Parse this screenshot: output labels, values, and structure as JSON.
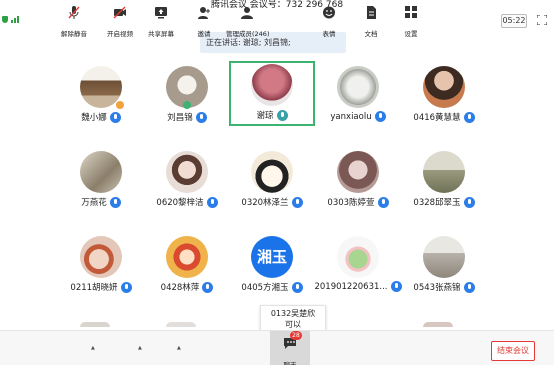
{
  "window": {
    "title": "腾讯会议 会议号：732 296 768",
    "timer": "05:22"
  },
  "speaking": {
    "label": "正在讲话:",
    "names": "谢琼; 刘昌锦;"
  },
  "participants": [
    {
      "name": "魏小娜",
      "avatar_color": "#8b6a4a",
      "badge": "host"
    },
    {
      "name": "刘昌锦",
      "avatar_color": "#a79b8d",
      "badge": "speaking"
    },
    {
      "name": "谢琼",
      "avatar_color": "#b0525f",
      "active": true
    },
    {
      "name": "yanxiaolu",
      "avatar_color": "#c9ccc5"
    },
    {
      "name": "0416黄慧慧",
      "avatar_color": "#6b4a3a"
    },
    {
      "name": "万燕花",
      "avatar_color": "#b3aa9a"
    },
    {
      "name": "0620黎梓洁",
      "avatar_color": "#d8c7bf"
    },
    {
      "name": "0320林泽兰",
      "avatar_color": "#efe6d8"
    },
    {
      "name": "0303陈婷萱",
      "avatar_color": "#9c7c79"
    },
    {
      "name": "0328邱翠玉",
      "avatar_color": "#a8a894"
    },
    {
      "name": "0211胡晓妍",
      "avatar_color": "#c59b86"
    },
    {
      "name": "0428林萍",
      "avatar_color": "#cc7b48"
    },
    {
      "name": "0405方湘玉",
      "avatar_color": "#1a73e8",
      "avatar_text": "湘玉"
    },
    {
      "name": "201901220631...",
      "avatar_color": "#f4f4f4"
    },
    {
      "name": "0543张燕锦",
      "avatar_color": "#b8b2aa"
    }
  ],
  "tooltip": {
    "line1": "0132吴楚欣",
    "line2": "可以"
  },
  "toolbar": {
    "unmute": "解除静音",
    "start_video": "开启视频",
    "share_screen": "共享屏幕",
    "invite": "邀请",
    "members": "管理成员(246)",
    "chat": "聊天",
    "chat_badge": "28",
    "reactions": "表情",
    "documents": "文档",
    "settings": "设置",
    "end": "结束会议"
  },
  "colors": {
    "accent": "#2b7de9",
    "active_border": "#3cb371",
    "danger": "#e53935",
    "banner": "#e6eef8"
  },
  "icons": [
    "shield-icon",
    "signal-icon",
    "fullscreen-icon",
    "mic-icon",
    "mic-off-icon",
    "video-off-icon",
    "share-screen-icon",
    "invite-icon",
    "members-icon",
    "chat-icon",
    "emoji-icon",
    "document-icon",
    "settings-icon"
  ]
}
